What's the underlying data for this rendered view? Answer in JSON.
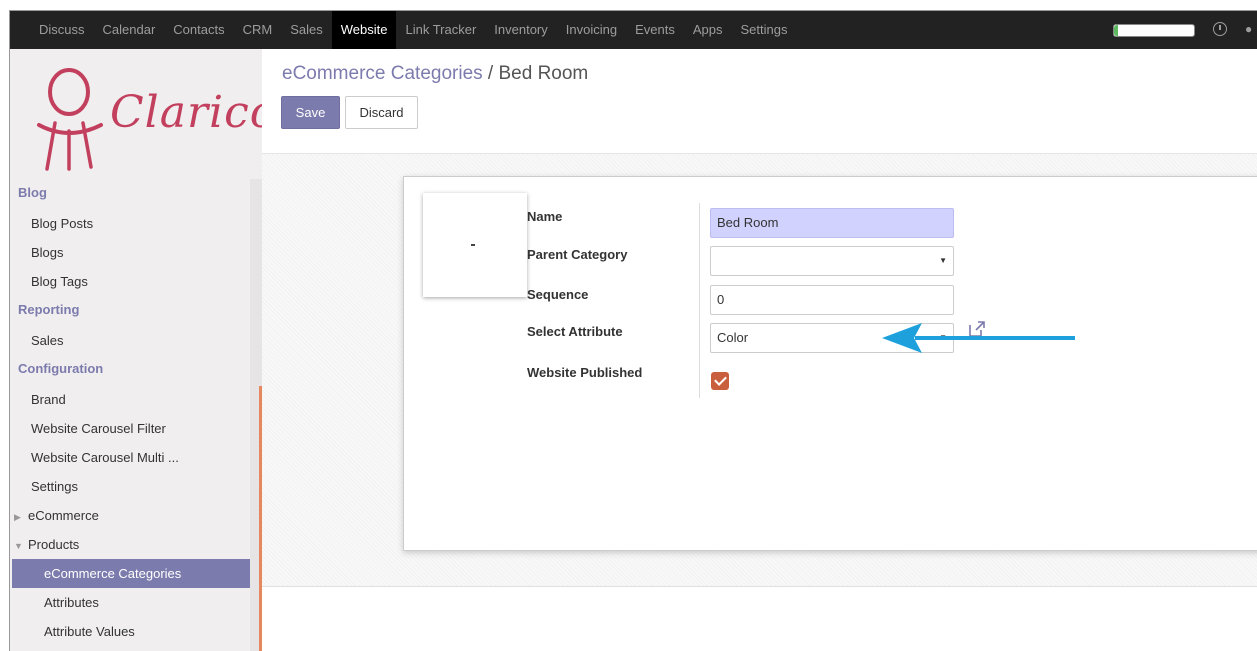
{
  "topbar": {
    "items": [
      "Discuss",
      "Calendar",
      "Contacts",
      "CRM",
      "Sales",
      "Website",
      "Link Tracker",
      "Inventory",
      "Invoicing",
      "Events",
      "Apps",
      "Settings"
    ],
    "active": "Website",
    "progress_fraction": 0.05
  },
  "logo": {
    "text": "Clarico"
  },
  "sidebar": {
    "blog": {
      "title": "Blog",
      "items": [
        "Blog Posts",
        "Blogs",
        "Blog Tags"
      ]
    },
    "reporting": {
      "title": "Reporting",
      "items": [
        "Sales"
      ]
    },
    "configuration": {
      "title": "Configuration",
      "items": [
        "Brand",
        "Website Carousel Filter",
        "Website Carousel Multi ...",
        "Settings"
      ],
      "ecommerce": "eCommerce",
      "products": "Products",
      "products_items": [
        "eCommerce Categories",
        "Attributes",
        "Attribute Values"
      ]
    }
  },
  "breadcrumb": {
    "parent": "eCommerce Categories",
    "separator": "/",
    "current": "Bed Room"
  },
  "buttons": {
    "save": "Save",
    "discard": "Discard"
  },
  "form": {
    "name_label": "Name",
    "name_value": "Bed Room",
    "parent_label": "Parent Category",
    "parent_value": "",
    "sequence_label": "Sequence",
    "sequence_value": "0",
    "attribute_label": "Select Attribute",
    "attribute_value": "Color",
    "published_label": "Website Published",
    "published_checked": true
  },
  "colors": {
    "brand": "#7c7bad",
    "logo": "#c2405e",
    "arrow": "#1ea0dc",
    "checkbox": "#c95f3c"
  },
  "icons": [
    "caret-right-icon",
    "caret-down-icon",
    "clock-icon",
    "external-link-icon",
    "arrow-annotation-icon",
    "logo-chair-icon"
  ]
}
